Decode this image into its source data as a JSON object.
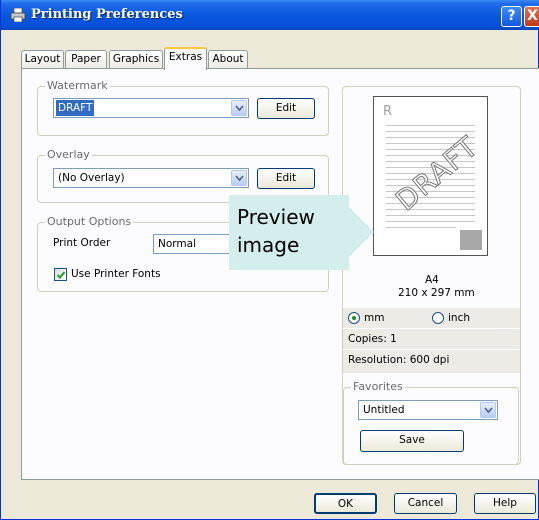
{
  "window": {
    "title": "Printing Preferences",
    "help_button": "?",
    "close_button": "X"
  },
  "tabs": [
    {
      "label": "Layout"
    },
    {
      "label": "Paper"
    },
    {
      "label": "Graphics"
    },
    {
      "label": "Extras",
      "active": true
    },
    {
      "label": "About"
    }
  ],
  "watermark": {
    "group_label": "Watermark",
    "selected": "DRAFT",
    "edit_label": "Edit"
  },
  "overlay": {
    "group_label": "Overlay",
    "selected": "(No Overlay)",
    "edit_label": "Edit"
  },
  "output_options": {
    "group_label": "Output Options",
    "print_order_label": "Print Order",
    "print_order_value": "Normal",
    "use_printer_fonts_label": "Use Printer Fonts",
    "use_printer_fonts_checked": true
  },
  "preview": {
    "page_letter": "R",
    "watermark_text": "DRAFT",
    "paper_name": "A4",
    "paper_size": "210 x 297 mm",
    "unit_mm_label": "mm",
    "unit_inch_label": "inch",
    "selected_unit": "mm",
    "copies_text": "Copies: 1",
    "resolution_text": "Resolution: 600 dpi"
  },
  "favorites": {
    "group_label": "Favorites",
    "selected": "Untitled",
    "save_label": "Save"
  },
  "footer": {
    "ok_label": "OK",
    "cancel_label": "Cancel",
    "help_label": "Help"
  },
  "callout": {
    "line1": "Preview",
    "line2": "image"
  },
  "colors": {
    "titlebar": "#0a58e0",
    "callout_bg": "#d4eded",
    "selection": "#316ac5",
    "tab_highlight": "#ffc83c"
  }
}
